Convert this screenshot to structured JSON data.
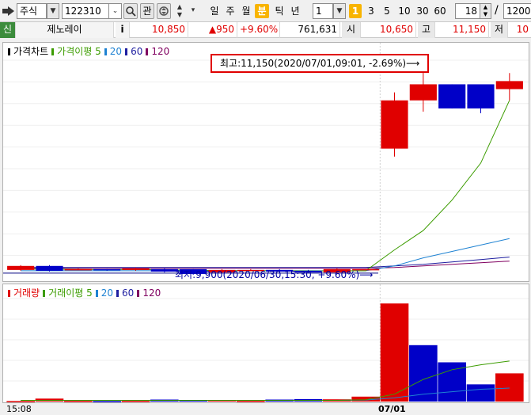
{
  "toolbar": {
    "market": "주식",
    "code": "122310",
    "search_icon": "magnifier-icon",
    "watch_label": "관",
    "periods": [
      "일",
      "주",
      "월",
      "분",
      "틱",
      "년"
    ],
    "active_period": "분",
    "interval_value": "1",
    "minute_options": [
      "1",
      "3",
      "5",
      "10",
      "30",
      "60"
    ],
    "active_minute": "1",
    "count_value": "18",
    "slash": "/",
    "total_value": "1200"
  },
  "info": {
    "badge": "신",
    "name": "제노레이",
    "info_button": "i",
    "price": "10,850",
    "change": "▲950",
    "change_pct": "+9.60%",
    "volume": "761,631",
    "open_label": "시",
    "open_value": "10,650",
    "high_label": "고",
    "high_value": "11,150",
    "low_label": "저",
    "low_value": "10"
  },
  "colors": {
    "up": "#e00000",
    "down": "#0000c8",
    "ma5": "#3c9c00",
    "ma20": "#1e82d2",
    "ma60": "#1e1ea0",
    "ma120": "#800060",
    "annotation_border": "#e00000"
  },
  "price_pane": {
    "legend": [
      {
        "label": "가격차트",
        "color": "#000000"
      },
      {
        "label": "가격이평 5",
        "color": "#3c9c00"
      },
      {
        "label": "20",
        "color": "#1e82d2"
      },
      {
        "label": "60",
        "color": "#1e1ea0"
      },
      {
        "label": "120",
        "color": "#800060"
      }
    ],
    "high_annotation": "최고:11,150(2020/07/01,09:01, -2.69%)⟶",
    "low_annotation": "최저:9,900(2020/06/30,15:30, +9.60%)⟶"
  },
  "volume_pane": {
    "legend": [
      {
        "label": "거래량",
        "color": "#e00000"
      },
      {
        "label": "거래이평 5",
        "color": "#3c9c00"
      },
      {
        "label": "20",
        "color": "#1e82d2"
      },
      {
        "label": "60",
        "color": "#1e1ea0"
      },
      {
        "label": "120",
        "color": "#800060"
      }
    ]
  },
  "time_axis": {
    "left_label": "15:08",
    "date_label": "07/01"
  },
  "chart_data": {
    "type": "candlestick",
    "price_candles": [
      {
        "open": 9895,
        "close": 9920,
        "high": 9925,
        "low": 9890
      },
      {
        "open": 9920,
        "close": 9890,
        "high": 9925,
        "low": 9885
      },
      {
        "open": 9900,
        "close": 9900,
        "high": 9905,
        "low": 9895
      },
      {
        "open": 9900,
        "close": 9895,
        "high": 9900,
        "low": 9890
      },
      {
        "open": 9895,
        "close": 9905,
        "high": 9910,
        "low": 9890
      },
      {
        "open": 9900,
        "close": 9885,
        "high": 9905,
        "low": 9880
      },
      {
        "open": 9900,
        "close": 9870,
        "high": 9900,
        "low": 9865
      },
      {
        "open": 9880,
        "close": 9895,
        "high": 9900,
        "low": 9875
      },
      {
        "open": 9895,
        "close": 9895,
        "high": 9900,
        "low": 9890
      },
      {
        "open": 9895,
        "close": 9885,
        "high": 9900,
        "low": 9880
      },
      {
        "open": 9890,
        "close": 9880,
        "high": 9895,
        "low": 9875
      },
      {
        "open": 9880,
        "close": 9900,
        "high": 9905,
        "low": 9875
      },
      {
        "open": 9900,
        "close": 9900,
        "high": 9900,
        "low": 9900
      },
      {
        "open": 10650,
        "close": 10950,
        "high": 11000,
        "low": 10600
      },
      {
        "open": 10950,
        "close": 11050,
        "high": 11150,
        "low": 10880
      },
      {
        "open": 11050,
        "close": 10900,
        "high": 11050,
        "low": 10900
      },
      {
        "open": 11050,
        "close": 10900,
        "high": 11050,
        "low": 10870
      },
      {
        "open": 11020,
        "close": 11070,
        "high": 11120,
        "low": 10950
      }
    ],
    "price_range": [
      9850,
      11200
    ],
    "ma5": [
      9900,
      9900,
      9898,
      9897,
      9898,
      9896,
      9893,
      9891,
      9890,
      9890,
      9889,
      9889,
      9890,
      10020,
      10140,
      10330,
      10560,
      10950
    ],
    "ma20": [
      9890,
      9890,
      9890,
      9890,
      9890,
      9890,
      9890,
      9890,
      9890,
      9890,
      9890,
      9890,
      9890,
      9920,
      9970,
      10010,
      10050,
      10090
    ],
    "ma60": [
      9910,
      9910,
      9910,
      9910,
      9910,
      9910,
      9910,
      9910,
      9910,
      9910,
      9910,
      9910,
      9910,
      9920,
      9930,
      9945,
      9960,
      9975
    ],
    "ma120": [
      9905,
      9905,
      9905,
      9905,
      9905,
      9905,
      9905,
      9905,
      9905,
      9905,
      9905,
      9905,
      9905,
      9910,
      9920,
      9930,
      9940,
      9950
    ],
    "volumes": [
      200,
      1200,
      300,
      200,
      300,
      800,
      600,
      500,
      300,
      800,
      1000,
      900,
      2000,
      40000,
      23000,
      16000,
      7000,
      11500
    ],
    "volume_up": [
      true,
      true,
      true,
      false,
      true,
      false,
      false,
      true,
      true,
      false,
      false,
      true,
      true,
      true,
      false,
      false,
      false,
      true
    ],
    "volume_range": [
      0,
      42000
    ],
    "vol_ma5": [
      500,
      500,
      500,
      500,
      500,
      500,
      500,
      500,
      500,
      500,
      500,
      500,
      700,
      3000,
      9000,
      13000,
      15000,
      16500
    ],
    "vol_ma20": [
      500,
      500,
      500,
      500,
      500,
      500,
      500,
      500,
      500,
      500,
      500,
      500,
      600,
      1500,
      3000,
      4000,
      5000,
      5500
    ]
  }
}
